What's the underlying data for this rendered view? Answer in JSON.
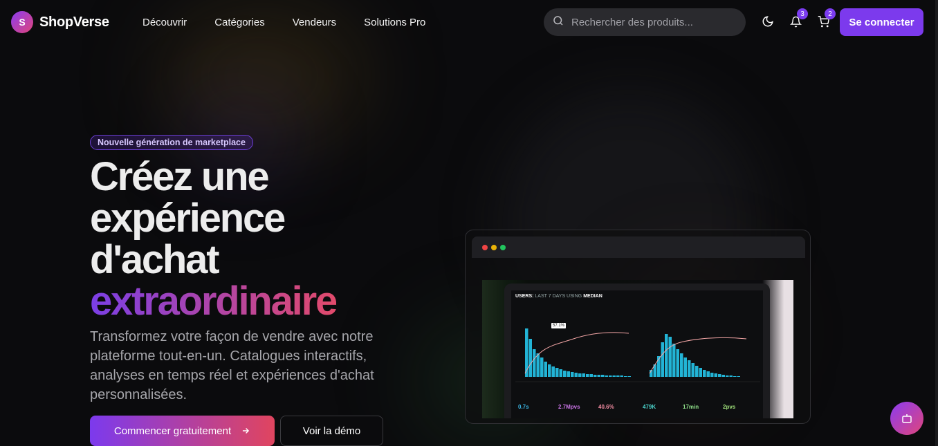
{
  "brand": {
    "initial": "S",
    "name": "ShopVerse"
  },
  "nav": {
    "links": [
      "Découvrir",
      "Catégories",
      "Vendeurs",
      "Solutions Pro"
    ]
  },
  "search": {
    "placeholder": "Rechercher des produits..."
  },
  "icons": {
    "theme": "moon-icon",
    "notifications": "bell-icon",
    "cart": "cart-icon",
    "search": "search-icon",
    "chat": "bot-icon"
  },
  "badges": {
    "notifications": "3",
    "cart": "2"
  },
  "auth": {
    "login_label": "Se connecter"
  },
  "hero": {
    "pill": "Nouvelle génération de marketplace",
    "title_lines": [
      "Créez une",
      "expérience",
      "d'achat"
    ],
    "title_highlight": "extraordinaire",
    "subtitle": "Transformez votre façon de vendre avec notre plateforme tout-en-un. Catalogues interactifs, analyses en temps réel et expériences d'achat personnalisées.",
    "cta_primary": "Commencer gratuitement",
    "cta_secondary": "Voir la démo"
  },
  "preview": {
    "dashboard": {
      "title_strong": "USERS:",
      "title_dim": "LAST 7 DAYS USING",
      "title_mode": "MEDIAN",
      "tooltip": "57.1%",
      "stats": [
        "0.7s",
        "2.7Mpvs",
        "40.6%",
        "479K",
        "17min",
        "2pvs"
      ]
    }
  },
  "colors": {
    "accent": "#7c3aed",
    "accent2": "#e0455f",
    "bg": "#0b0b0d"
  }
}
